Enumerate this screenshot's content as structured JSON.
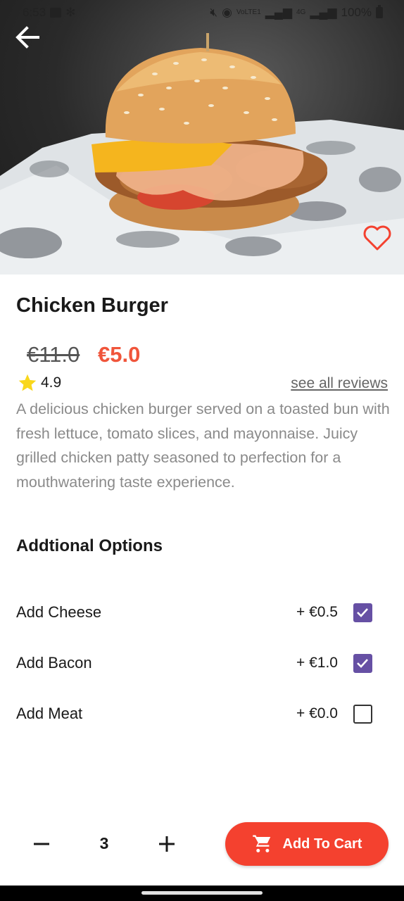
{
  "status_bar": {
    "time": "6:53",
    "network_small_1": "VoLTE1",
    "network_small_2": "4G",
    "battery": "100%"
  },
  "product": {
    "image_alt": "Chicken burger photo",
    "title": "Chicken Burger",
    "old_price": "€11.0",
    "new_price": "€5.0",
    "rating": "4.9",
    "reviews_link": "see all reviews",
    "description": "A delicious chicken burger served on a toasted bun with fresh lettuce, tomato slices, and mayonnaise. Juicy grilled chicken patty seasoned to perfection for a mouthwatering taste experience.",
    "favorite": false
  },
  "options": {
    "heading": "Addtional Options",
    "items": [
      {
        "label": "Add Cheese",
        "price": "+ €0.5",
        "checked": true
      },
      {
        "label": "Add Bacon",
        "price": "+ €1.0",
        "checked": true
      },
      {
        "label": "Add Meat",
        "price": "+ €0.0",
        "checked": false
      }
    ]
  },
  "cart": {
    "quantity": "3",
    "button_label": "Add To Cart"
  },
  "colors": {
    "accent": "#f4412f",
    "price": "#f0553b",
    "checkbox": "#6650a4",
    "star": "#f9d71c"
  },
  "icons": {
    "back": "arrow-left-icon",
    "favorite": "heart-outline-icon",
    "star": "star-icon",
    "minus": "minus-icon",
    "plus": "plus-icon",
    "cart": "shopping-cart-icon",
    "check": "checkmark-icon"
  }
}
